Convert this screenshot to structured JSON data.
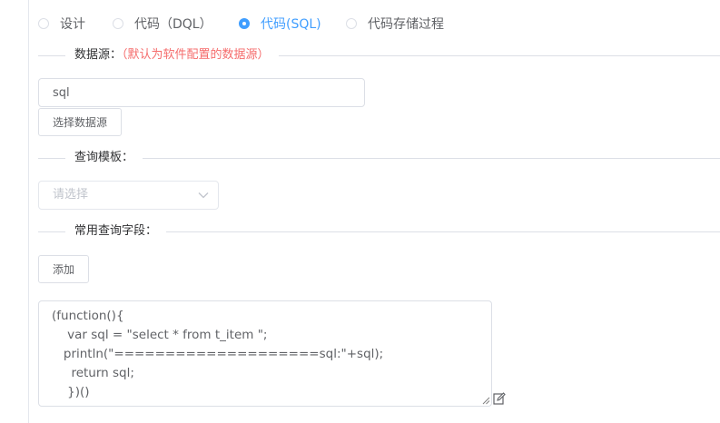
{
  "mode": {
    "options": [
      {
        "label": "设计",
        "checked": false
      },
      {
        "label": "代码（DQL）",
        "checked": false
      },
      {
        "label": "代码(SQL)",
        "checked": true
      },
      {
        "label": "代码存储过程",
        "checked": false
      }
    ]
  },
  "datasource": {
    "title": "数据源：",
    "hint": "（默认为软件配置的数据源）",
    "value": "sql",
    "choose_label": "选择数据源"
  },
  "template": {
    "title": "查询模板：",
    "placeholder": "请选择"
  },
  "fields": {
    "title": "常用查询字段：",
    "add_label": "添加"
  },
  "code": {
    "lines": [
      "(function(){",
      "    var sql = \"select * from t_item \";",
      "   println(\"====================sql:\"+sql);",
      "     return sql;",
      "    })()"
    ]
  },
  "icons": {
    "radio": "radio-icon",
    "chevron": "chevron-down-icon",
    "resize": "resize-handle-icon",
    "edit": "edit-icon"
  },
  "colors": {
    "accent": "#409eff",
    "hint": "#f56c6c",
    "text": "#606266",
    "border": "#dcdfe6"
  }
}
